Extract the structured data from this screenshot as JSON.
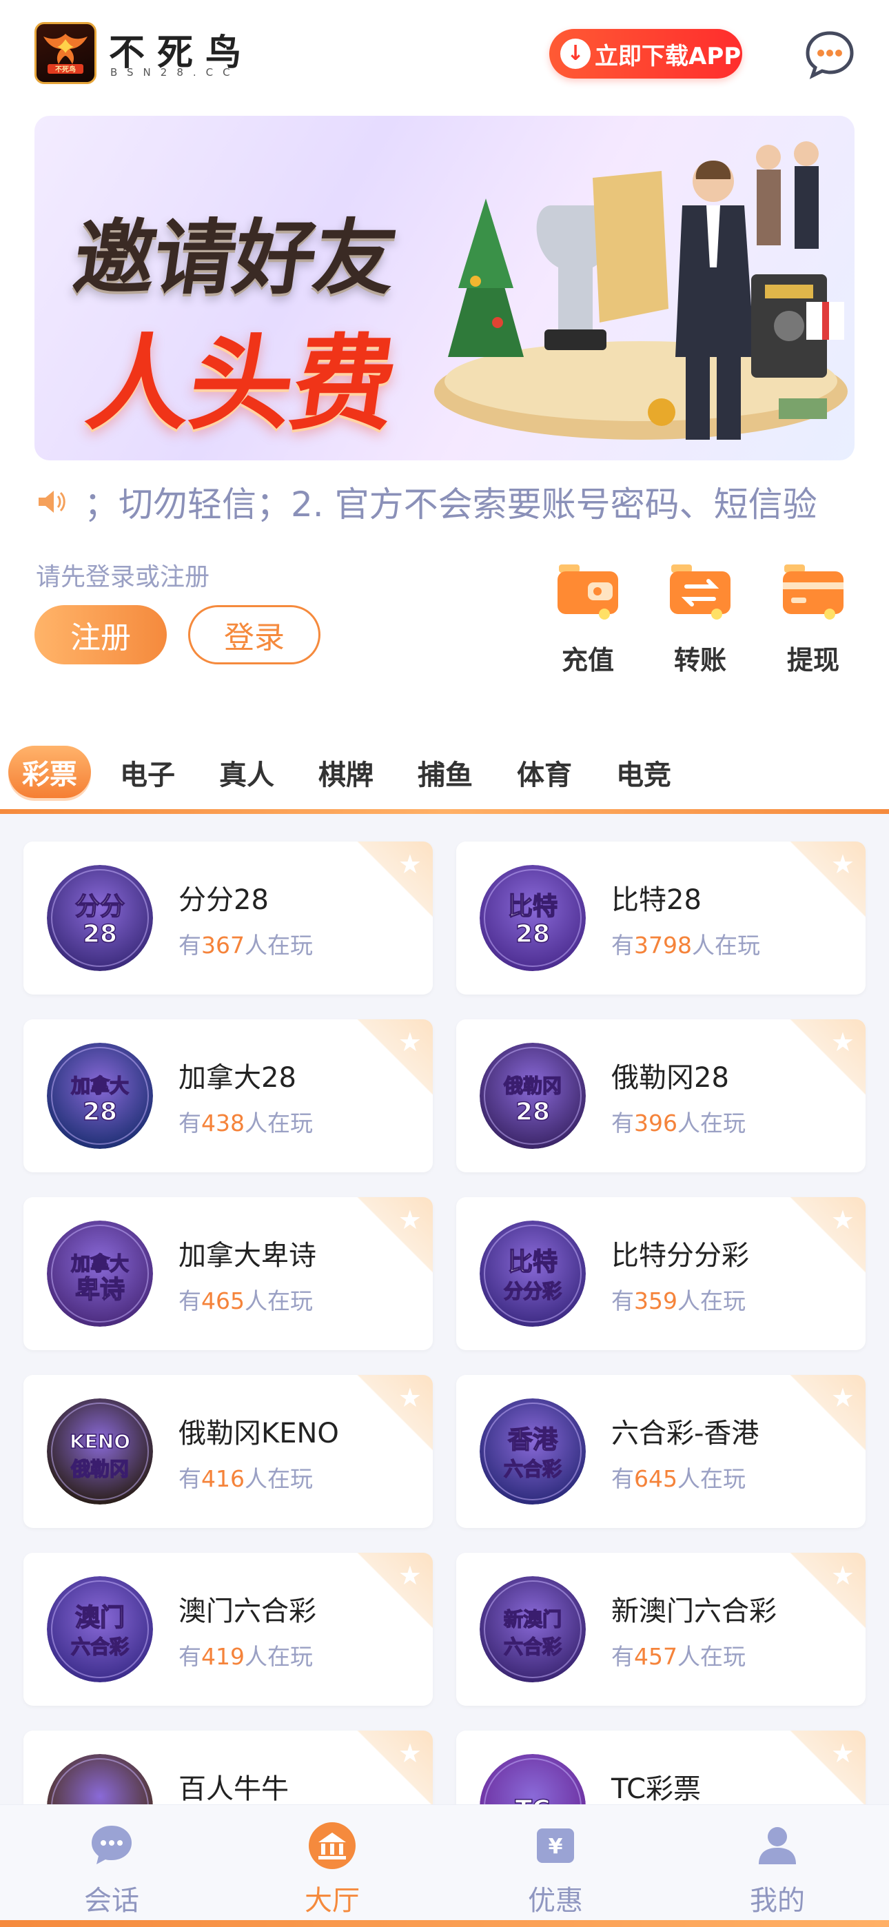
{
  "header": {
    "brand_name": "不死鸟",
    "brand_domain": "BSN28.CC",
    "download_label": "立即下载APP"
  },
  "banner": {
    "line1": "邀请好友",
    "line2": "人头费"
  },
  "notice": {
    "text": "；切勿轻信；2. 官方不会索要账号密码、短信验"
  },
  "account": {
    "hint": "请先登录或注册",
    "register_label": "注册",
    "login_label": "登录"
  },
  "quick_actions": [
    {
      "label": "充值",
      "icon": "wallet-icon"
    },
    {
      "label": "转账",
      "icon": "transfer-icon"
    },
    {
      "label": "提现",
      "icon": "card-icon"
    }
  ],
  "tabs": [
    "彩票",
    "电子",
    "真人",
    "棋牌",
    "捕鱼",
    "体育",
    "电竞"
  ],
  "active_tab": "彩票",
  "players_prefix": "有",
  "players_suffix": "人在玩",
  "games": [
    {
      "name": "分分28",
      "players": "367",
      "icon_text": [
        "分分",
        "28"
      ],
      "color": "#3a2a7a"
    },
    {
      "name": "比特28",
      "players": "3798",
      "icon_text": [
        "比特",
        "28"
      ],
      "color": "#4b2c8f"
    },
    {
      "name": "加拿大28",
      "players": "438",
      "icon_text": [
        "加拿大",
        "28"
      ],
      "color": "#1d2f73"
    },
    {
      "name": "俄勒冈28",
      "players": "396",
      "icon_text": [
        "俄勒冈",
        "28"
      ],
      "color": "#3a2466"
    },
    {
      "name": "加拿大卑诗",
      "players": "465",
      "icon_text": [
        "加拿大",
        "卑诗"
      ],
      "color": "#4a2a7c"
    },
    {
      "name": "比特分分彩",
      "players": "359",
      "icon_text": [
        "比特",
        "分分彩"
      ],
      "color": "#3c2a82"
    },
    {
      "name": "俄勒冈KENO",
      "players": "416",
      "icon_text": [
        "KENO",
        "俄勒冈"
      ],
      "color": "#2a1e18"
    },
    {
      "name": "六合彩-香港",
      "players": "645",
      "icon_text": [
        "香港",
        "六合彩"
      ],
      "color": "#2b2a7a"
    },
    {
      "name": "澳门六合彩",
      "players": "419",
      "icon_text": [
        "澳门",
        "六合彩"
      ],
      "color": "#3b2c8a"
    },
    {
      "name": "新澳门六合彩",
      "players": "457",
      "icon_text": [
        "新澳门",
        "六合彩"
      ],
      "color": "#3a2572"
    },
    {
      "name": "百人牛牛",
      "players": "",
      "icon_text": [
        "",
        ""
      ],
      "color": "#4a2e1c"
    },
    {
      "name": "TC彩票",
      "players": "",
      "icon_text": [
        "TC",
        ""
      ],
      "color": "#6a2a9a"
    }
  ],
  "bottom_nav": [
    {
      "label": "会话",
      "icon": "chat-bubble-icon"
    },
    {
      "label": "大厅",
      "icon": "hall-icon"
    },
    {
      "label": "优惠",
      "icon": "yen-gift-icon"
    },
    {
      "label": "我的",
      "icon": "user-icon"
    }
  ],
  "colors": {
    "accent": "#f58a3d",
    "download": "#ff3b2e",
    "muted": "#9aa0c4"
  }
}
